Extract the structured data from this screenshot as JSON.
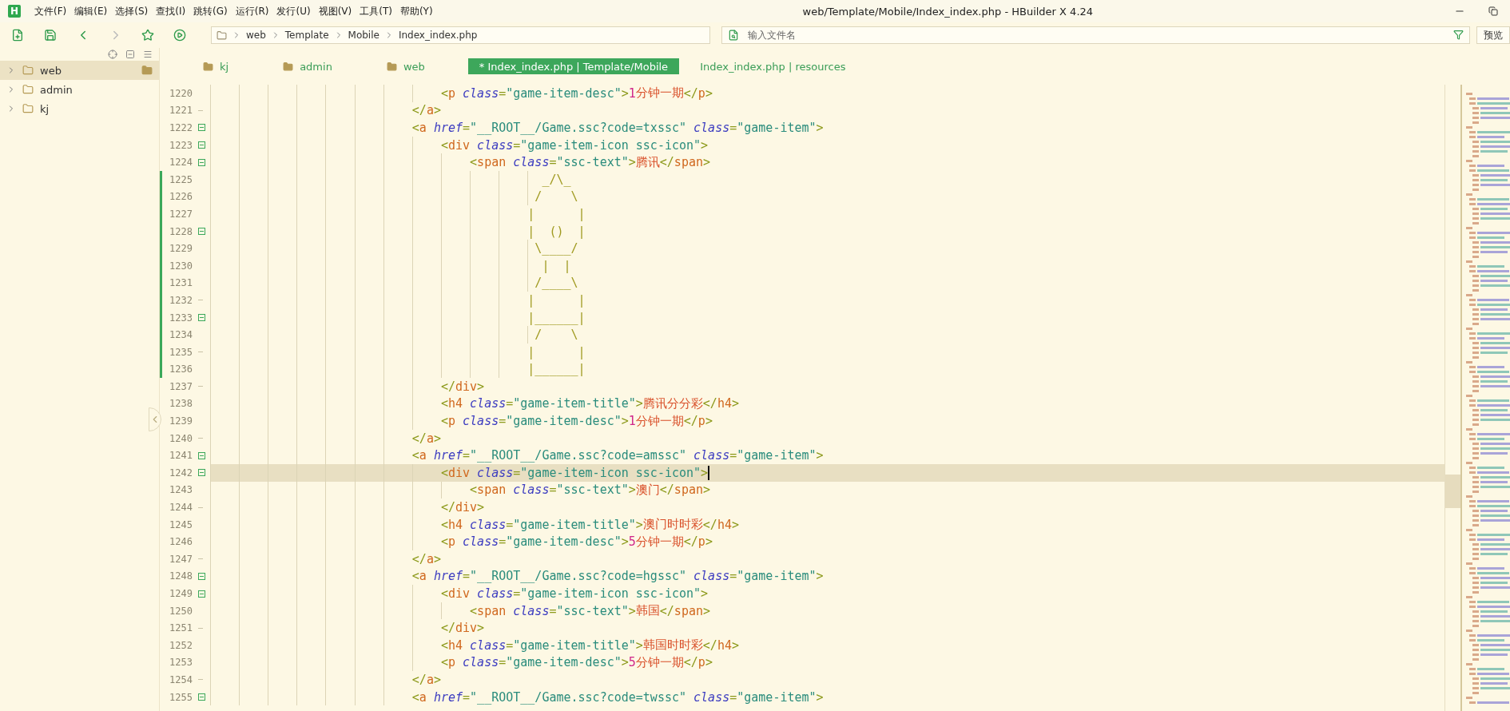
{
  "app": {
    "logo": "H",
    "title": "web/Template/Mobile/Index_index.php - HBuilder X 4.24"
  },
  "menu": [
    "文件(F)",
    "编辑(E)",
    "选择(S)",
    "查找(I)",
    "跳转(G)",
    "运行(R)",
    "发行(U)",
    "视图(V)",
    "工具(T)",
    "帮助(Y)"
  ],
  "breadcrumb": [
    "web",
    "Template",
    "Mobile",
    "Index_index.php"
  ],
  "search": {
    "placeholder": "输入文件名"
  },
  "preview_button": "预览",
  "sidebar": {
    "items": [
      {
        "label": "web",
        "selected": true
      },
      {
        "label": "admin",
        "selected": false
      },
      {
        "label": "kj",
        "selected": false
      }
    ]
  },
  "tabs": [
    {
      "label": "kj",
      "kind": "folder",
      "selected": false
    },
    {
      "label": "admin",
      "kind": "folder",
      "selected": false
    },
    {
      "label": "web",
      "kind": "folder",
      "selected": false
    },
    {
      "label": "* Index_index.php | Template/Mobile",
      "kind": "file",
      "selected": true
    },
    {
      "label": "Index_index.php | resources",
      "kind": "file",
      "selected": false
    }
  ],
  "lines": [
    {
      "number": "1220",
      "kind": "markup",
      "fold_start": false,
      "fold_end": false,
      "modified": false,
      "current": false,
      "text": "                                <p class=\"game-item-desc\">1分钟一期</p>"
    },
    {
      "number": "1221",
      "kind": "markup",
      "fold_start": false,
      "fold_end": true,
      "modified": false,
      "current": false,
      "text": "                            </a>"
    },
    {
      "number": "1222",
      "kind": "markup",
      "fold_start": true,
      "fold_end": false,
      "modified": false,
      "current": false,
      "text": "                            <a href=\"__ROOT__/Game.ssc?code=txssc\" class=\"game-item\">"
    },
    {
      "number": "1223",
      "kind": "markup",
      "fold_start": true,
      "fold_end": false,
      "modified": false,
      "current": false,
      "text": "                                <div class=\"game-item-icon ssc-icon\">"
    },
    {
      "number": "1224",
      "kind": "markup",
      "fold_start": true,
      "fold_end": false,
      "modified": false,
      "current": false,
      "text": "                                    <span class=\"ssc-text\">腾讯</span>"
    },
    {
      "number": "1225",
      "kind": "art",
      "fold_start": false,
      "fold_end": false,
      "modified": true,
      "current": false,
      "text": "                                              _/\\_"
    },
    {
      "number": "1226",
      "kind": "art",
      "fold_start": false,
      "fold_end": false,
      "modified": true,
      "current": false,
      "text": "                                             /    \\"
    },
    {
      "number": "1227",
      "kind": "art",
      "fold_start": false,
      "fold_end": false,
      "modified": true,
      "current": false,
      "text": "                                            |      |"
    },
    {
      "number": "1228",
      "kind": "art",
      "fold_start": true,
      "fold_end": false,
      "modified": true,
      "current": false,
      "text": "                                            |  ()  |"
    },
    {
      "number": "1229",
      "kind": "art",
      "fold_start": false,
      "fold_end": false,
      "modified": true,
      "current": false,
      "text": "                                             \\____/"
    },
    {
      "number": "1230",
      "kind": "art",
      "fold_start": false,
      "fold_end": false,
      "modified": true,
      "current": false,
      "text": "                                              |  |"
    },
    {
      "number": "1231",
      "kind": "art",
      "fold_start": false,
      "fold_end": false,
      "modified": true,
      "current": false,
      "text": "                                             /____\\"
    },
    {
      "number": "1232",
      "kind": "art",
      "fold_start": false,
      "fold_end": true,
      "modified": true,
      "current": false,
      "text": "                                            |      |"
    },
    {
      "number": "1233",
      "kind": "art",
      "fold_start": true,
      "fold_end": false,
      "modified": true,
      "current": false,
      "text": "                                            |______|"
    },
    {
      "number": "1234",
      "kind": "art",
      "fold_start": false,
      "fold_end": false,
      "modified": true,
      "current": false,
      "text": "                                             /    \\"
    },
    {
      "number": "1235",
      "kind": "art",
      "fold_start": false,
      "fold_end": true,
      "modified": true,
      "current": false,
      "text": "                                            |      |"
    },
    {
      "number": "1236",
      "kind": "art",
      "fold_start": false,
      "fold_end": false,
      "modified": true,
      "current": false,
      "text": "                                            |______|"
    },
    {
      "number": "1237",
      "kind": "markup",
      "fold_start": false,
      "fold_end": true,
      "modified": false,
      "current": false,
      "text": "                                </div>"
    },
    {
      "number": "1238",
      "kind": "markup",
      "fold_start": false,
      "fold_end": false,
      "modified": false,
      "current": false,
      "text": "                                <h4 class=\"game-item-title\">腾讯分分彩</h4>"
    },
    {
      "number": "1239",
      "kind": "markup",
      "fold_start": false,
      "fold_end": false,
      "modified": false,
      "current": false,
      "text": "                                <p class=\"game-item-desc\">1分钟一期</p>"
    },
    {
      "number": "1240",
      "kind": "markup",
      "fold_start": false,
      "fold_end": true,
      "modified": false,
      "current": false,
      "text": "                            </a>"
    },
    {
      "number": "1241",
      "kind": "markup",
      "fold_start": true,
      "fold_end": false,
      "modified": false,
      "current": false,
      "text": "                            <a href=\"__ROOT__/Game.ssc?code=amssc\" class=\"game-item\">"
    },
    {
      "number": "1242",
      "kind": "markup",
      "fold_start": true,
      "fold_end": false,
      "modified": false,
      "current": true,
      "text": "                                <div class=\"game-item-icon ssc-icon\">"
    },
    {
      "number": "1243",
      "kind": "markup",
      "fold_start": false,
      "fold_end": false,
      "modified": false,
      "current": false,
      "text": "                                    <span class=\"ssc-text\">澳门</span>"
    },
    {
      "number": "1244",
      "kind": "markup",
      "fold_start": false,
      "fold_end": true,
      "modified": false,
      "current": false,
      "text": "                                </div>"
    },
    {
      "number": "1245",
      "kind": "markup",
      "fold_start": false,
      "fold_end": false,
      "modified": false,
      "current": false,
      "text": "                                <h4 class=\"game-item-title\">澳门时时彩</h4>"
    },
    {
      "number": "1246",
      "kind": "markup",
      "fold_start": false,
      "fold_end": false,
      "modified": false,
      "current": false,
      "text": "                                <p class=\"game-item-desc\">5分钟一期</p>"
    },
    {
      "number": "1247",
      "kind": "markup",
      "fold_start": false,
      "fold_end": true,
      "modified": false,
      "current": false,
      "text": "                            </a>"
    },
    {
      "number": "1248",
      "kind": "markup",
      "fold_start": true,
      "fold_end": false,
      "modified": false,
      "current": false,
      "text": "                            <a href=\"__ROOT__/Game.ssc?code=hgssc\" class=\"game-item\">"
    },
    {
      "number": "1249",
      "kind": "markup",
      "fold_start": true,
      "fold_end": false,
      "modified": false,
      "current": false,
      "text": "                                <div class=\"game-item-icon ssc-icon\">"
    },
    {
      "number": "1250",
      "kind": "markup",
      "fold_start": false,
      "fold_end": false,
      "modified": false,
      "current": false,
      "text": "                                    <span class=\"ssc-text\">韩国</span>"
    },
    {
      "number": "1251",
      "kind": "markup",
      "fold_start": false,
      "fold_end": true,
      "modified": false,
      "current": false,
      "text": "                                </div>"
    },
    {
      "number": "1252",
      "kind": "markup",
      "fold_start": false,
      "fold_end": false,
      "modified": false,
      "current": false,
      "text": "                                <h4 class=\"game-item-title\">韩国时时彩</h4>"
    },
    {
      "number": "1253",
      "kind": "markup",
      "fold_start": false,
      "fold_end": false,
      "modified": false,
      "current": false,
      "text": "                                <p class=\"game-item-desc\">5分钟一期</p>"
    },
    {
      "number": "1254",
      "kind": "markup",
      "fold_start": false,
      "fold_end": true,
      "modified": false,
      "current": false,
      "text": "                            </a>"
    },
    {
      "number": "1255",
      "kind": "markup",
      "fold_start": true,
      "fold_end": false,
      "modified": false,
      "current": false,
      "text": "                            <a href=\"__ROOT__/Game.ssc?code=twssc\" class=\"game-item\">"
    }
  ]
}
